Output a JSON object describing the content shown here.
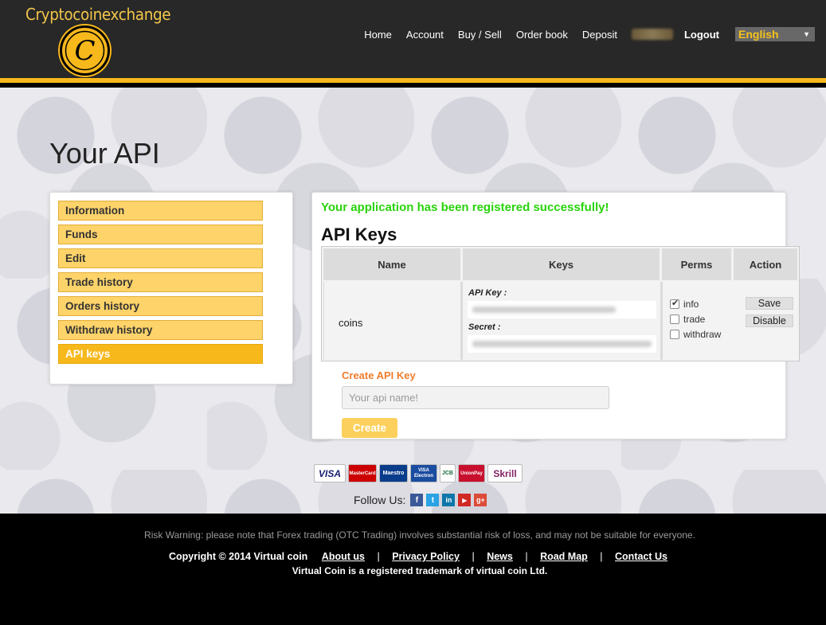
{
  "header": {
    "logo_text": "Cryptocoinexchange",
    "logo_letter": "C",
    "nav": [
      "Home",
      "Account",
      "Buy / Sell",
      "Order book",
      "Deposit"
    ],
    "logout": "Logout",
    "language": "English"
  },
  "page_title": "Your API",
  "sidebar": {
    "items": [
      "Information",
      "Funds",
      "Edit",
      "Trade history",
      "Orders history",
      "Withdraw history",
      "API keys"
    ],
    "active": "API keys"
  },
  "content": {
    "success_message": "Your application has been registered successfully!",
    "section_title": "API Keys",
    "table": {
      "headers": [
        "Name",
        "Keys",
        "Perms",
        "Action"
      ],
      "row": {
        "name": "coins",
        "api_key_label": "API Key :",
        "secret_label": "Secret :",
        "perms": [
          {
            "label": "info",
            "checked": true
          },
          {
            "label": "trade",
            "checked": false
          },
          {
            "label": "withdraw",
            "checked": false
          }
        ],
        "actions": [
          "Save",
          "Disable"
        ]
      }
    },
    "create_label": "Create API Key",
    "input_placeholder": "Your api name!",
    "create_button": "Create"
  },
  "payments": [
    "VISA",
    "MasterCard",
    "Maestro",
    "VISA Electron",
    "JCB",
    "UnionPay",
    "Skrill"
  ],
  "follow_us": "Follow Us:",
  "social": [
    "f",
    "t",
    "in",
    "▶",
    "g+"
  ],
  "footer": {
    "risk_warning": "Risk Warning: please note that Forex trading (OTC Trading) involves substantial risk of loss, and may not be suitable for everyone.",
    "copyright": "Copyright © 2014 Virtual coin",
    "links": [
      "About us",
      "Privacy Policy",
      "News",
      "Road Map",
      "Contact Us"
    ],
    "trademark": "Virtual Coin is a registered trademark of virtual coin Ltd."
  },
  "colors": {
    "accent": "#f7b81c",
    "success": "#29d30c",
    "create_label": "#ee7c2c"
  }
}
